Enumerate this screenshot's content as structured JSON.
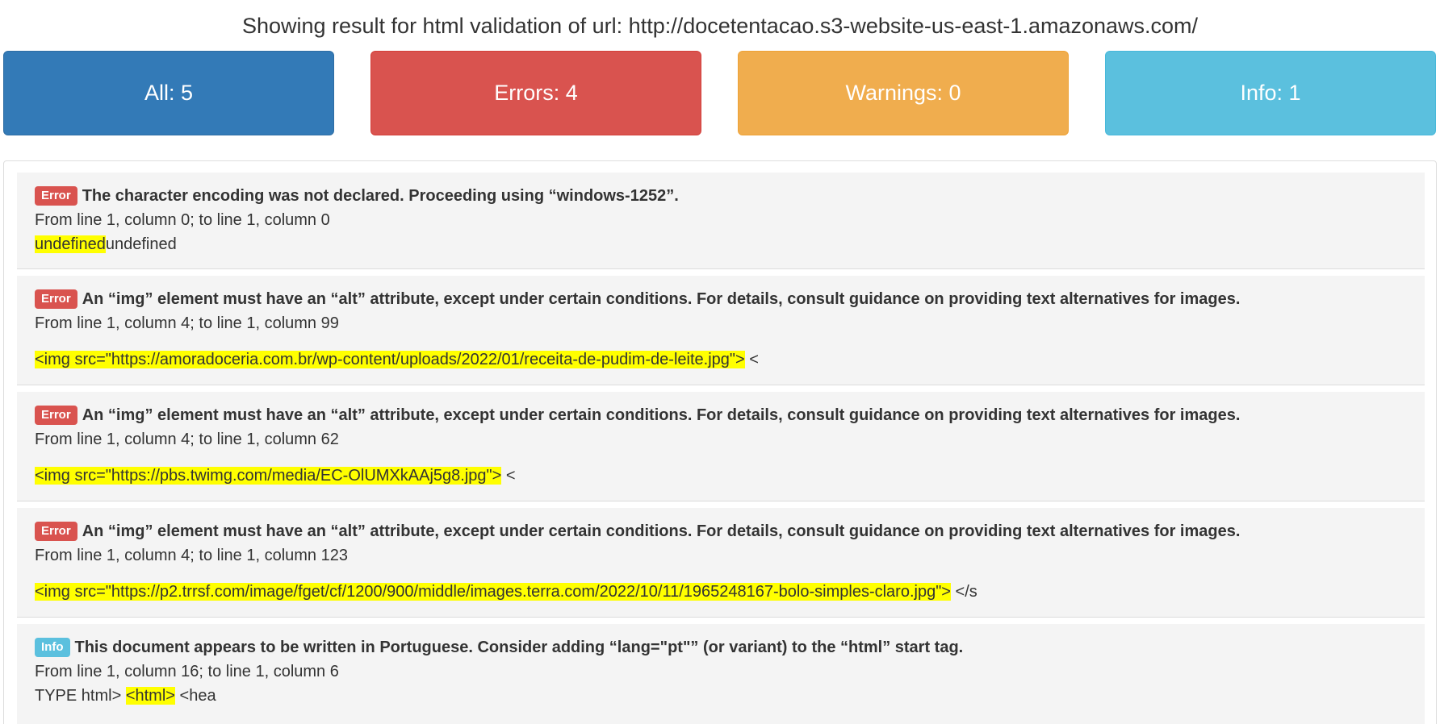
{
  "heading": "Showing result for html validation of url: http://docetentacao.s3-website-us-east-1.amazonaws.com/",
  "filters": {
    "all": "All: 5",
    "errors": "Errors: 4",
    "warnings": "Warnings: 0",
    "info": "Info: 1"
  },
  "colors": {
    "all": "#337ab7",
    "errors": "#d9534f",
    "warnings": "#f0ad4e",
    "info": "#5bc0de",
    "highlight": "#ffff00"
  },
  "results": [
    {
      "type": "Error",
      "message": "The character encoding was not declared. Proceeding using “windows-1252”.",
      "location": "From line 1, column 0; to line 1, column 0",
      "extract_before": "",
      "extract_highlight": "undefined",
      "extract_after": "undefined"
    },
    {
      "type": "Error",
      "message": "An “img” element must have an “alt” attribute, except under certain conditions. For details, consult guidance on providing text alternatives for images.",
      "location": "From line 1, column 4; to line 1, column 99",
      "extract_before": "",
      "extract_highlight": "<img src=\"https://amoradoceria.com.br/wp-content/uploads/2022/01/receita-de-pudim-de-leite.jpg\">",
      "extract_after": " <"
    },
    {
      "type": "Error",
      "message": "An “img” element must have an “alt” attribute, except under certain conditions. For details, consult guidance on providing text alternatives for images.",
      "location": "From line 1, column 4; to line 1, column 62",
      "extract_before": "",
      "extract_highlight": "<img src=\"https://pbs.twimg.com/media/EC-OlUMXkAAj5g8.jpg\">",
      "extract_after": " <"
    },
    {
      "type": "Error",
      "message": "An “img” element must have an “alt” attribute, except under certain conditions. For details, consult guidance on providing text alternatives for images.",
      "location": "From line 1, column 4; to line 1, column 123",
      "extract_before": "",
      "extract_highlight": "<img src=\"https://p2.trrsf.com/image/fget/cf/1200/900/middle/images.terra.com/2022/10/11/1965248167-bolo-simples-claro.jpg\">",
      "extract_after": " </s"
    },
    {
      "type": "Info",
      "message": "This document appears to be written in Portuguese. Consider adding “lang=\"pt\"” (or variant) to the “html” start tag.",
      "location": "From line 1, column 16; to line 1, column 6",
      "extract_before": "TYPE html> ",
      "extract_highlight": "<html>",
      "extract_after": " <hea"
    }
  ]
}
